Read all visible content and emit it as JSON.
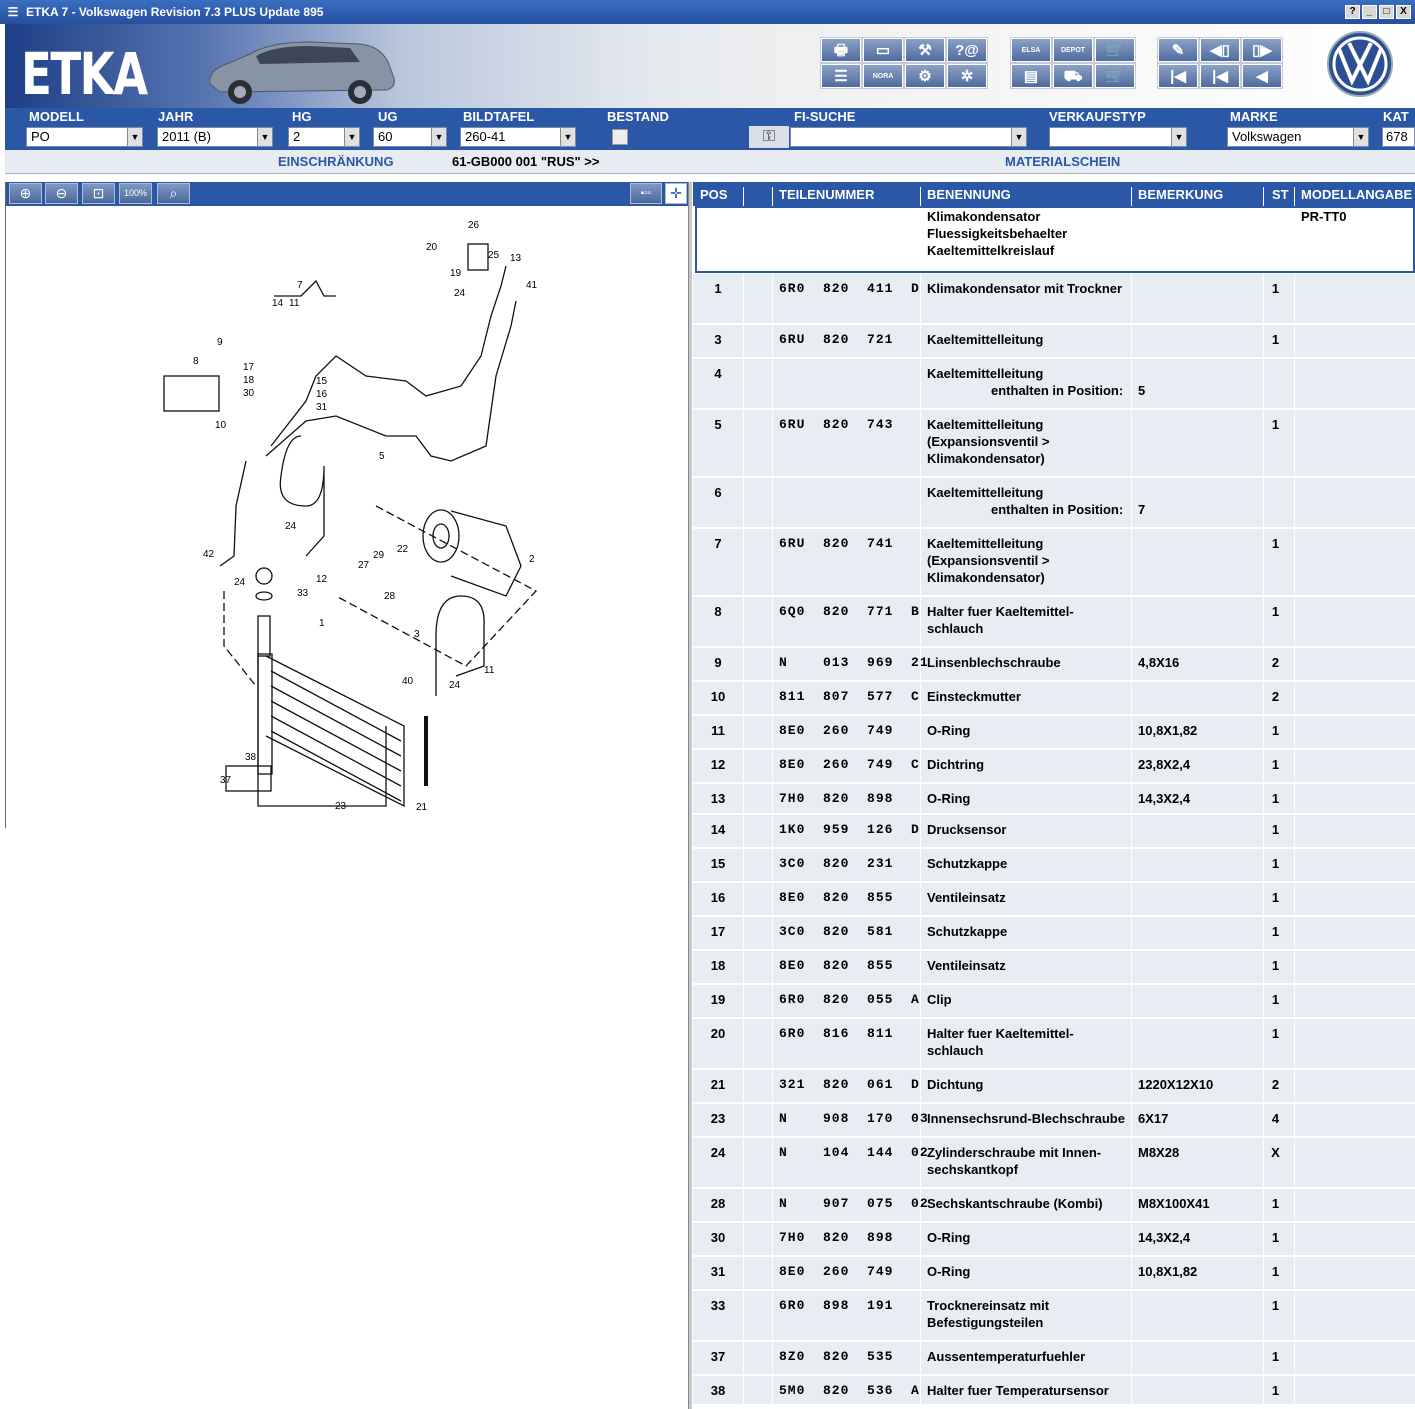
{
  "window": {
    "title": "ETKA 7 - Volkswagen Revision 7.3 PLUS Update 895",
    "buttons": [
      "?",
      "_",
      "□",
      "X"
    ]
  },
  "banner": {
    "logo_text": "ETKA",
    "brand_logo": "vw-logo"
  },
  "toolbar": {
    "icons": [
      "printer-icon",
      "screen-icon",
      "tools-icon",
      "help-email-icon",
      "print-list-icon",
      "nora-icon",
      "assembly-icon",
      "wheel-icon",
      "elsa-icon",
      "depot-icon",
      "cart-add-icon",
      "cart-list-icon",
      "cart-icon",
      "pin-icon",
      "prev-page-icon",
      "next-page-icon",
      "first-icon",
      "back-icon",
      "left-icon"
    ],
    "labels": {
      "nora": "NORA",
      "elsa": "ELSA",
      "depot": "DEPOT"
    }
  },
  "fields": {
    "modell": {
      "label": "MODELL",
      "value": "PO"
    },
    "jahr": {
      "label": "JAHR",
      "value": "2011 (B)"
    },
    "hg": {
      "label": "HG",
      "value": "2"
    },
    "ug": {
      "label": "UG",
      "value": "60"
    },
    "bildtafel": {
      "label": "BILDTAFEL",
      "value": "260-41"
    },
    "bestand": {
      "label": "BESTAND"
    },
    "fi_suche": {
      "label": "FI-SUCHE",
      "value": ""
    },
    "verkaufstyp": {
      "label": "VERKAUFSTYP",
      "value": ""
    },
    "marke": {
      "label": "MARKE",
      "value": "Volkswagen"
    },
    "kat": {
      "label": "KAT",
      "value": "678"
    }
  },
  "info": {
    "einschraenkung_label": "EINSCHRÄNKUNG",
    "einschraenkung_value": "61-GB000 001 \"RUS\" >>",
    "materialschein_label": "MATERIALSCHEIN"
  },
  "zoom_tools": [
    "zoom-in-icon",
    "zoom-out-icon",
    "zoom-fit-icon",
    "zoom-100-icon",
    "magnifier-icon"
  ],
  "zoom_100_label": "100%",
  "table": {
    "headers": {
      "pos": "POS",
      "teilenummer": "TEILENUMMER",
      "benennung": "BENENNUNG",
      "bemerkung": "BEMERKUNG",
      "st": "ST",
      "modellangabe": "MODELLANGABE"
    },
    "header_block": {
      "line1": "Klimakondensator",
      "line2": "Fluessigkeitsbehaelter",
      "line3": "Kaeltemittelkreislauf",
      "modellangabe": "PR-TT0"
    },
    "rows": [
      {
        "pos": "1",
        "pn": "6R0  820  411  D",
        "name": "Klimakondensator mit Trockner",
        "bem": "",
        "st": "1"
      },
      {
        "pos": "3",
        "pn": "6RU  820  721",
        "name": "Kaeltemittelleitung",
        "bem": "",
        "st": "1"
      },
      {
        "pos": "4",
        "pn": "",
        "name": "Kaeltemittelleitung",
        "sub": "enthalten in Position:",
        "bem": "5",
        "st": ""
      },
      {
        "pos": "5",
        "pn": "6RU  820  743",
        "name": "Kaeltemittelleitung (Expansionsventil > Klimakondensator)",
        "bem": "",
        "st": "1"
      },
      {
        "pos": "6",
        "pn": "",
        "name": "Kaeltemittelleitung",
        "sub": "enthalten in Position:",
        "bem": "7",
        "st": ""
      },
      {
        "pos": "7",
        "pn": "6RU  820  741",
        "name": "Kaeltemittelleitung (Expansionsventil > Klimakondensator)",
        "bem": "",
        "st": "1"
      },
      {
        "pos": "8",
        "pn": "6Q0  820  771  B",
        "name": "Halter fuer Kaeltemittel-schlauch",
        "bem": "",
        "st": "1"
      },
      {
        "pos": "9",
        "pn": "N    013  969  21",
        "name": "Linsenblechschraube",
        "bem": "4,8X16",
        "st": "2"
      },
      {
        "pos": "10",
        "pn": "811  807  577  C",
        "name": "Einsteckmutter",
        "bem": "",
        "st": "2"
      },
      {
        "pos": "11",
        "pn": "8E0  260  749",
        "name": "O-Ring",
        "bem": "10,8X1,82",
        "st": "1"
      },
      {
        "pos": "12",
        "pn": "8E0  260  749  C",
        "name": "Dichtring",
        "bem": "23,8X2,4",
        "st": "1"
      },
      {
        "pos": "13",
        "pn": "7H0  820  898",
        "name": "O-Ring",
        "bem": "14,3X2,4",
        "st": "1"
      },
      {
        "pos": "14",
        "pn": "1K0  959  126  D",
        "name": "Drucksensor",
        "bem": "",
        "st": "1"
      },
      {
        "pos": "15",
        "pn": "3C0  820  231",
        "name": "Schutzkappe",
        "bem": "",
        "st": "1"
      },
      {
        "pos": "16",
        "pn": "8E0  820  855",
        "name": "Ventileinsatz",
        "bem": "",
        "st": "1"
      },
      {
        "pos": "17",
        "pn": "3C0  820  581",
        "name": "Schutzkappe",
        "bem": "",
        "st": "1"
      },
      {
        "pos": "18",
        "pn": "8E0  820  855",
        "name": "Ventileinsatz",
        "bem": "",
        "st": "1"
      },
      {
        "pos": "19",
        "pn": "6R0  820  055  A",
        "name": "Clip",
        "bem": "",
        "st": "1"
      },
      {
        "pos": "20",
        "pn": "6R0  816  811",
        "name": "Halter fuer Kaeltemittel-schlauch",
        "bem": "",
        "st": "1"
      },
      {
        "pos": "21",
        "pn": "321  820  061  D",
        "name": "Dichtung",
        "bem": "1220X12X10",
        "st": "2"
      },
      {
        "pos": "23",
        "pn": "N    908  170  03",
        "name": "Innensechsrund-Blechschraube",
        "bem": "6X17",
        "st": "4"
      },
      {
        "pos": "24",
        "pn": "N    104  144  02",
        "name": "Zylinderschraube mit Innen-sechskantkopf",
        "bem": "M8X28",
        "st": "X"
      },
      {
        "pos": "28",
        "pn": "N    907  075  02",
        "name": "Sechskantschraube (Kombi)",
        "bem": "M8X100X41",
        "st": "1"
      },
      {
        "pos": "30",
        "pn": "7H0  820  898",
        "name": "O-Ring",
        "bem": "14,3X2,4",
        "st": "1"
      },
      {
        "pos": "31",
        "pn": "8E0  260  749",
        "name": "O-Ring",
        "bem": "10,8X1,82",
        "st": "1"
      },
      {
        "pos": "33",
        "pn": "6R0  898  191",
        "name": "Trocknereinsatz mit Befestigungsteilen",
        "bem": "",
        "st": "1"
      },
      {
        "pos": "37",
        "pn": "8Z0  820  535",
        "name": "Aussentemperaturfuehler",
        "bem": "",
        "st": "1"
      },
      {
        "pos": "38",
        "pn": "5M0  820  536  A",
        "name": "Halter fuer Temperatursensor",
        "bem": "",
        "st": "1"
      }
    ]
  },
  "diagram": {
    "callouts": [
      "26",
      "20",
      "25",
      "13",
      "19",
      "41",
      "24",
      "7",
      "14",
      "11",
      "9",
      "8",
      "17",
      "18",
      "30",
      "15",
      "16",
      "31",
      "10",
      "5",
      "24",
      "42",
      "24",
      "12",
      "27",
      "29",
      "22",
      "28",
      "2",
      "33",
      "1",
      "3",
      "40",
      "24",
      "11",
      "38",
      "37",
      "23",
      "21"
    ]
  }
}
